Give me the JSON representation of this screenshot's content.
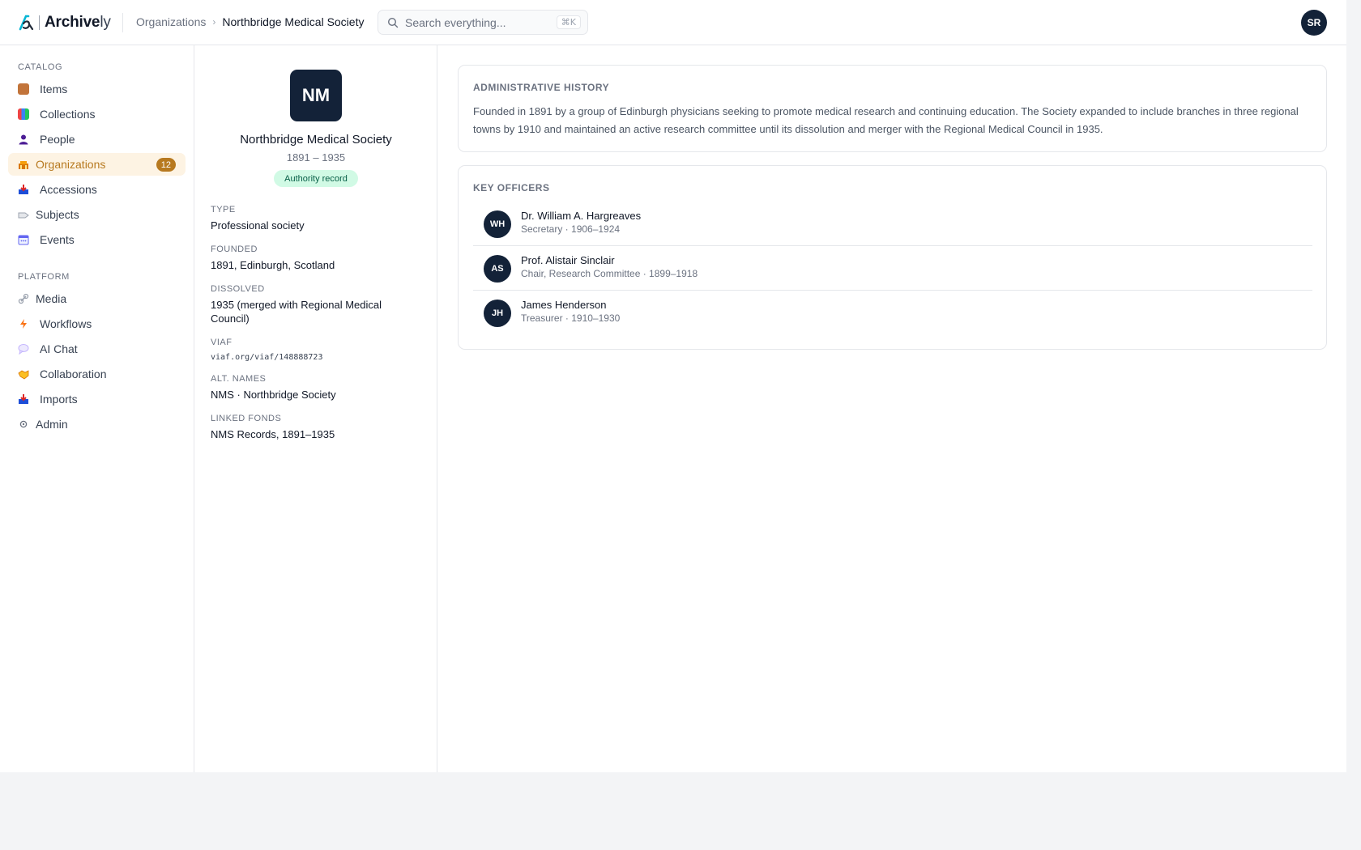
{
  "app": {
    "logo_main": "Archive",
    "logo_accent": "ly"
  },
  "breadcrumb": {
    "parent": "Organizations",
    "separator": "›",
    "current": "Northbridge Medical Society"
  },
  "search": {
    "placeholder": "Search everything...",
    "shortcut": "⌘K"
  },
  "user": {
    "initials": "SR"
  },
  "sidebar": {
    "catalog_label": "CATALOG",
    "platform_label": "PLATFORM",
    "catalog_items": [
      {
        "label": "Items",
        "icon": "box-icon"
      },
      {
        "label": "Collections",
        "icon": "books-icon"
      },
      {
        "label": "People",
        "icon": "person-icon"
      },
      {
        "label": "Organizations",
        "icon": "building-icon",
        "active": true,
        "badge": "12"
      },
      {
        "label": "Accessions",
        "icon": "inbox-icon"
      },
      {
        "label": "Subjects",
        "icon": "tag-icon"
      },
      {
        "label": "Events",
        "icon": "calendar-icon"
      }
    ],
    "platform_items": [
      {
        "label": "Media",
        "icon": "link-icon"
      },
      {
        "label": "Workflows",
        "icon": "lightning-icon"
      },
      {
        "label": "AI Chat",
        "icon": "chat-bubble-icon"
      },
      {
        "label": "Collaboration",
        "icon": "handshake-icon"
      },
      {
        "label": "Imports",
        "icon": "inbox-tray-icon"
      },
      {
        "label": "Admin",
        "icon": "gear-icon"
      }
    ]
  },
  "profile": {
    "initials": "NM",
    "name": "Northbridge Medical Society",
    "dates": "1891 – 1935",
    "badge": "Authority record",
    "fields": [
      {
        "label": "TYPE",
        "value": "Professional society"
      },
      {
        "label": "FOUNDED",
        "value": "1891, Edinburgh, Scotland"
      },
      {
        "label": "DISSOLVED",
        "value": "1935 (merged with Regional Medical Council)"
      },
      {
        "label": "VIAF",
        "value": "viaf.org/viaf/148888723"
      },
      {
        "label": "ALT. NAMES",
        "value": "NMS · Northbridge Society"
      },
      {
        "label": "LINKED FONDS",
        "value": "NMS Records, 1891–1935"
      }
    ]
  },
  "history": {
    "title": "ADMINISTRATIVE HISTORY",
    "text": "Founded in 1891 by a group of Edinburgh physicians seeking to promote medical research and continuing education. The Society expanded to include branches in three regional towns by 1910 and maintained an active research committee until its dissolution and merger with the Regional Medical Council in 1935."
  },
  "officers": {
    "title": "KEY OFFICERS",
    "items": [
      {
        "initials": "WH",
        "name": "Dr. William A. Hargreaves",
        "role": "Secretary · 1906–1924"
      },
      {
        "initials": "AS",
        "name": "Prof. Alistair Sinclair",
        "role": "Chair, Research Committee · 1899–1918"
      },
      {
        "initials": "JH",
        "name": "James Henderson",
        "role": "Treasurer · 1910–1930"
      }
    ]
  },
  "colors": {
    "accent": "#b7791f",
    "accent_bg": "#fdf3e3",
    "navy": "#132238",
    "logo_cyan": "#06b6d4",
    "badge_green_bg": "#d1fae5",
    "badge_green_text": "#065f46"
  }
}
